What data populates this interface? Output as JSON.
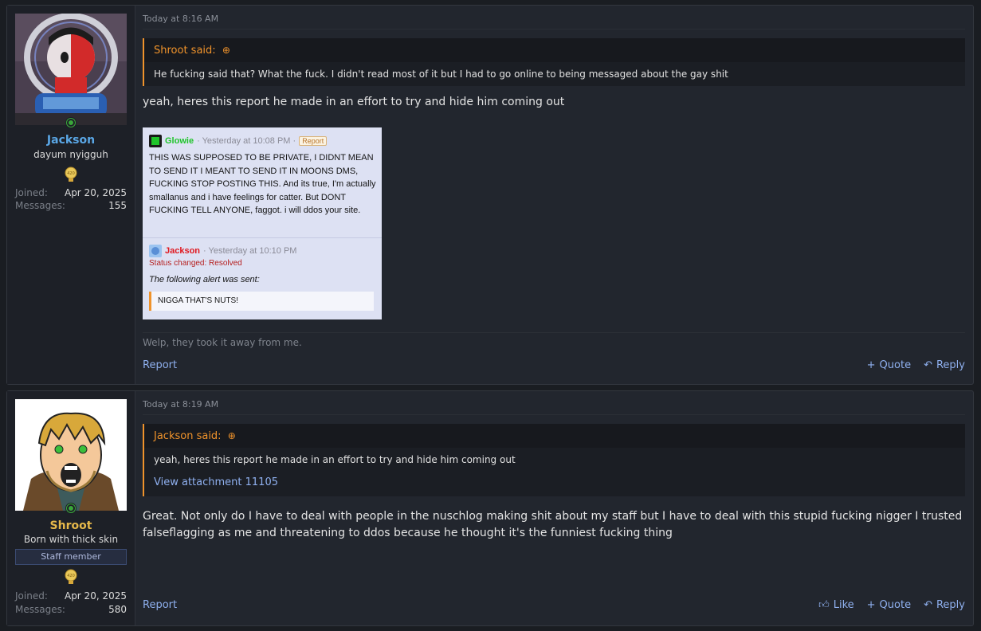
{
  "posts": [
    {
      "user": {
        "name": "Jackson",
        "title": "dayum nyigguh",
        "joined_label": "Joined:",
        "joined": "Apr 20, 2025",
        "messages_label": "Messages:",
        "messages": "155",
        "name_color": "#5aa7e6"
      },
      "date": "Today at 8:16 AM",
      "quote": {
        "author": "Shroot said:",
        "text": "He fucking said that? What the fuck. I didn't read most of it but I had to go online to being messaged about the gay shit"
      },
      "message": "yeah, heres this report he made in an effort to try and hide him coming out",
      "attachment": {
        "reporter": "Glowie",
        "report_time": "· Yesterday at 10:08 PM ·",
        "report_badge": "Report",
        "report_text": "THIS WAS SUPPOSED TO BE PRIVATE, I DIDNT MEAN TO SEND IT I MEANT TO SEND IT IN MOONS DMS, FUCKING STOP POSTING THIS. And its true, I'm actually smallanus and i have feelings for catter. But DONT FUCKING TELL ANYONE, faggot. i will ddos your site.",
        "resolver": "Jackson",
        "resolve_time": "· Yesterday at 10:10 PM",
        "status": "Status changed: Resolved",
        "alert_label": "The following alert was sent:",
        "alert_text": "NIGGA THAT'S NUTS!"
      },
      "signature": "Welp, they took it away from me.",
      "actions": {
        "report": "Report",
        "quote": "Quote",
        "reply": "Reply"
      }
    },
    {
      "user": {
        "name": "Shroot",
        "title": "Born with thick skin",
        "badge": "Staff member",
        "joined_label": "Joined:",
        "joined": "Apr 20, 2025",
        "messages_label": "Messages:",
        "messages": "580",
        "name_color": "#e6b84a"
      },
      "date": "Today at 8:19 AM",
      "quote": {
        "author": "Jackson said:",
        "text": "yeah, heres this report he made in an effort to try and hide him coming out",
        "link": "View attachment 11105"
      },
      "message": "Great. Not only do I have to deal with people in the nuschlog making shit about my staff but I have to deal with this stupid fucking nigger I trusted falseflagging as me and threatening to ddos because he thought it's the funniest fucking thing",
      "actions": {
        "report": "Report",
        "like": "Like",
        "quote": "Quote",
        "reply": "Reply"
      }
    }
  ],
  "icons": {
    "online": "online-dot-icon",
    "trophy": "trophy-icon",
    "quote_arrow": "arrow-up-circle-icon",
    "quote": "plus-icon",
    "reply": "reply-arrow-icon",
    "like": "thumbs-up-icon"
  }
}
